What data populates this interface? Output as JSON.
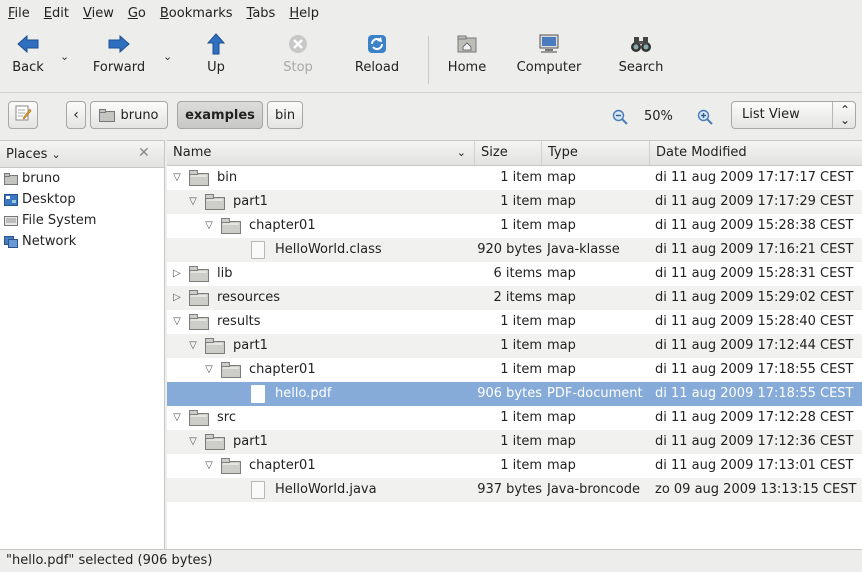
{
  "menu": [
    {
      "u": "F",
      "rest": "ile"
    },
    {
      "u": "E",
      "rest": "dit"
    },
    {
      "u": "V",
      "rest": "iew"
    },
    {
      "u": "G",
      "rest": "o"
    },
    {
      "u": "B",
      "rest": "ookmarks"
    },
    {
      "u": "T",
      "rest": "abs"
    },
    {
      "u": "H",
      "rest": "elp"
    }
  ],
  "toolbar": {
    "back": "Back",
    "forward": "Forward",
    "up": "Up",
    "stop": "Stop",
    "reload": "Reload",
    "home": "Home",
    "computer": "Computer",
    "search": "Search"
  },
  "location": {
    "back_chevron": "‹",
    "crumbs": [
      "bruno",
      "examples",
      "bin"
    ],
    "zoom": "50%",
    "view": "List View"
  },
  "sidebar": {
    "title": "Places",
    "items": [
      "bruno",
      "Desktop",
      "File System",
      "Network"
    ]
  },
  "columns": {
    "name": "Name",
    "size": "Size",
    "type": "Type",
    "date": "Date Modified"
  },
  "files": [
    {
      "name": "bin",
      "size": "1 item",
      "type": "map",
      "date": "di 11 aug 2009 17:17:17 CEST",
      "kind": "folder",
      "expander": "open",
      "depth": 0
    },
    {
      "name": "part1",
      "size": "1 item",
      "type": "map",
      "date": "di 11 aug 2009 17:17:29 CEST",
      "kind": "folder",
      "expander": "open",
      "depth": 1
    },
    {
      "name": "chapter01",
      "size": "1 item",
      "type": "map",
      "date": "di 11 aug 2009 15:28:38 CEST",
      "kind": "folder",
      "expander": "open",
      "depth": 2
    },
    {
      "name": "HelloWorld.class",
      "size": "920 bytes",
      "type": "Java-klasse",
      "date": "di 11 aug 2009 17:16:21 CEST",
      "kind": "file",
      "expander": "",
      "depth": 3
    },
    {
      "name": "lib",
      "size": "6 items",
      "type": "map",
      "date": "di 11 aug 2009 15:28:31 CEST",
      "kind": "folder",
      "expander": "closed",
      "depth": 0
    },
    {
      "name": "resources",
      "size": "2 items",
      "type": "map",
      "date": "di 11 aug 2009 15:29:02 CEST",
      "kind": "folder",
      "expander": "closed",
      "depth": 0
    },
    {
      "name": "results",
      "size": "1 item",
      "type": "map",
      "date": "di 11 aug 2009 15:28:40 CEST",
      "kind": "folder",
      "expander": "open",
      "depth": 0
    },
    {
      "name": "part1",
      "size": "1 item",
      "type": "map",
      "date": "di 11 aug 2009 17:12:44 CEST",
      "kind": "folder",
      "expander": "open",
      "depth": 1
    },
    {
      "name": "chapter01",
      "size": "1 item",
      "type": "map",
      "date": "di 11 aug 2009 17:18:55 CEST",
      "kind": "folder",
      "expander": "open",
      "depth": 2
    },
    {
      "name": "hello.pdf",
      "size": "906 bytes",
      "type": "PDF-document",
      "date": "di 11 aug 2009 17:18:55 CEST",
      "kind": "file",
      "expander": "",
      "depth": 3,
      "selected": true
    },
    {
      "name": "src",
      "size": "1 item",
      "type": "map",
      "date": "di 11 aug 2009 17:12:28 CEST",
      "kind": "folder",
      "expander": "open",
      "depth": 0
    },
    {
      "name": "part1",
      "size": "1 item",
      "type": "map",
      "date": "di 11 aug 2009 17:12:36 CEST",
      "kind": "folder",
      "expander": "open",
      "depth": 1
    },
    {
      "name": "chapter01",
      "size": "1 item",
      "type": "map",
      "date": "di 11 aug 2009 17:13:01 CEST",
      "kind": "folder",
      "expander": "open",
      "depth": 2
    },
    {
      "name": "HelloWorld.java",
      "size": "937 bytes",
      "type": "Java-broncode",
      "date": "zo 09 aug 2009 13:13:15 CEST",
      "kind": "file",
      "expander": "",
      "depth": 3
    }
  ],
  "status": "\"hello.pdf\" selected (906 bytes)",
  "colors": {
    "selection": "#86abd9",
    "folder": "#c9c9c5",
    "accent_blue": "#2f6fbf"
  }
}
